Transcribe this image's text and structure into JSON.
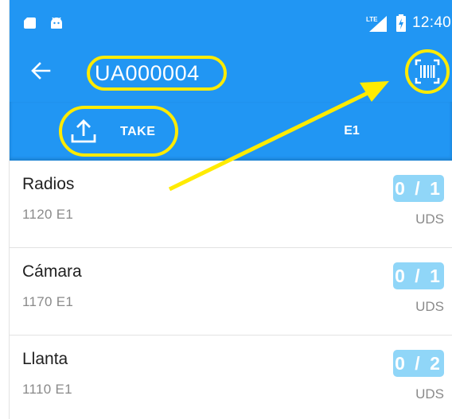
{
  "status_bar": {
    "network_label": "LTE",
    "time": "12:40",
    "icons": [
      "sd-card-icon",
      "android-icon",
      "signal-lte-icon",
      "battery-charging-icon"
    ]
  },
  "app_bar": {
    "title": "UA000004",
    "back_icon": "arrow-left-icon",
    "scan_icon": "barcode-scan-icon"
  },
  "tabs": [
    {
      "label": "TAKE",
      "icon": "upload-icon"
    },
    {
      "label": "E1"
    }
  ],
  "items": [
    {
      "name": "Radios",
      "code": "1120 E1",
      "qty": "0 / 1",
      "unit": "UDS"
    },
    {
      "name": "Cámara",
      "code": "1170 E1",
      "qty": "0 / 1",
      "unit": "UDS"
    },
    {
      "name": "Llanta",
      "code": "1110 E1",
      "qty": "0 / 2",
      "unit": "UDS"
    }
  ],
  "colors": {
    "primary": "#2196f3",
    "highlight": "#ffeb00",
    "badge": "#90d6f8",
    "text_primary": "#212121",
    "text_secondary": "#8a8a8a"
  }
}
